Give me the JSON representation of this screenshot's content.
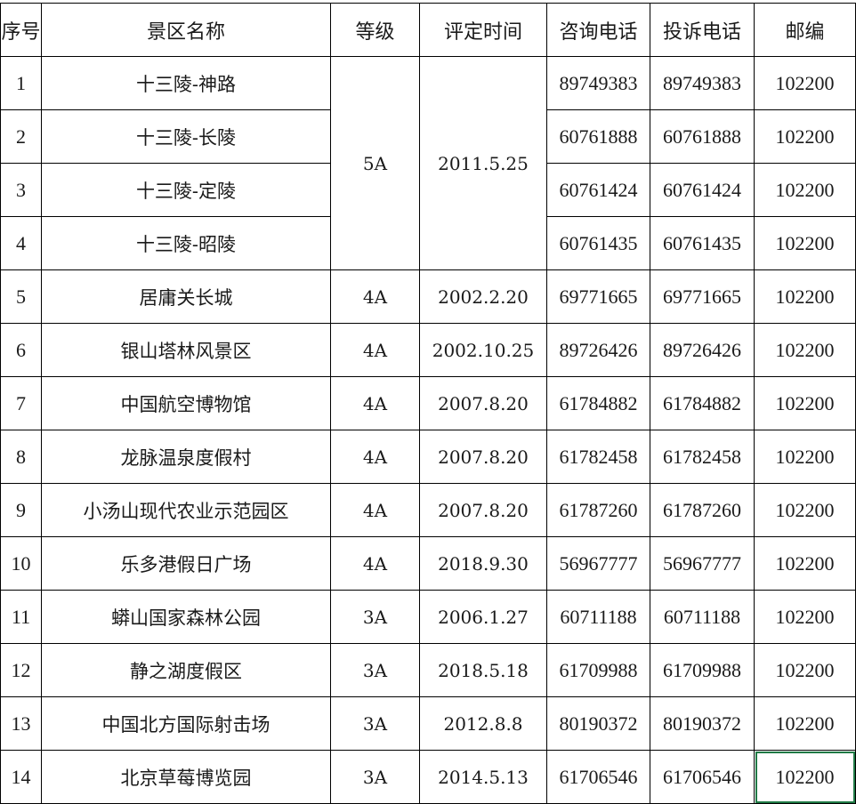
{
  "headers": [
    "序号",
    "景区名称",
    "等级",
    "评定时间",
    "咨询电话",
    "投诉电话",
    "邮编"
  ],
  "merged_group": {
    "grade": "5A",
    "date": "2011.5.25"
  },
  "rows": [
    {
      "no": "1",
      "name": "十三陵-神路",
      "grade": "",
      "date": "",
      "consult": "89749383",
      "complaint": "89749383",
      "zip": "102200"
    },
    {
      "no": "2",
      "name": "十三陵-长陵",
      "grade": "",
      "date": "",
      "consult": "60761888",
      "complaint": "60761888",
      "zip": "102200"
    },
    {
      "no": "3",
      "name": "十三陵-定陵",
      "grade": "",
      "date": "",
      "consult": "60761424",
      "complaint": "60761424",
      "zip": "102200"
    },
    {
      "no": "4",
      "name": "十三陵-昭陵",
      "grade": "",
      "date": "",
      "consult": "60761435",
      "complaint": "60761435",
      "zip": "102200"
    },
    {
      "no": "5",
      "name": "居庸关长城",
      "grade": "4A",
      "date": "2002.2.20",
      "consult": "69771665",
      "complaint": "69771665",
      "zip": "102200"
    },
    {
      "no": "6",
      "name": "银山塔林风景区",
      "grade": "4A",
      "date": "2002.10.25",
      "consult": "89726426",
      "complaint": "89726426",
      "zip": "102200"
    },
    {
      "no": "7",
      "name": "中国航空博物馆",
      "grade": "4A",
      "date": "2007.8.20",
      "consult": "61784882",
      "complaint": "61784882",
      "zip": "102200"
    },
    {
      "no": "8",
      "name": "龙脉温泉度假村",
      "grade": "4A",
      "date": "2007.8.20",
      "consult": "61782458",
      "complaint": "61782458",
      "zip": "102200"
    },
    {
      "no": "9",
      "name": "小汤山现代农业示范园区",
      "grade": "4A",
      "date": "2007.8.20",
      "consult": "61787260",
      "complaint": "61787260",
      "zip": "102200"
    },
    {
      "no": "10",
      "name": "乐多港假日广场",
      "grade": "4A",
      "date": "2018.9.30",
      "consult": "56967777",
      "complaint": "56967777",
      "zip": "102200"
    },
    {
      "no": "11",
      "name": "蟒山国家森林公园",
      "grade": "3A",
      "date": "2006.1.27",
      "consult": "60711188",
      "complaint": "60711188",
      "zip": "102200"
    },
    {
      "no": "12",
      "name": "静之湖度假区",
      "grade": "3A",
      "date": "2018.5.18",
      "consult": "61709988",
      "complaint": "61709988",
      "zip": "102200"
    },
    {
      "no": "13",
      "name": "中国北方国际射击场",
      "grade": "3A",
      "date": "2012.8.8",
      "consult": "80190372",
      "complaint": "80190372",
      "zip": "102200"
    },
    {
      "no": "14",
      "name": "北京草莓博览园",
      "grade": "3A",
      "date": "2014.5.13",
      "consult": "61706546",
      "complaint": "61706546",
      "zip": "102200"
    }
  ],
  "selection_color": "#1f7a45"
}
